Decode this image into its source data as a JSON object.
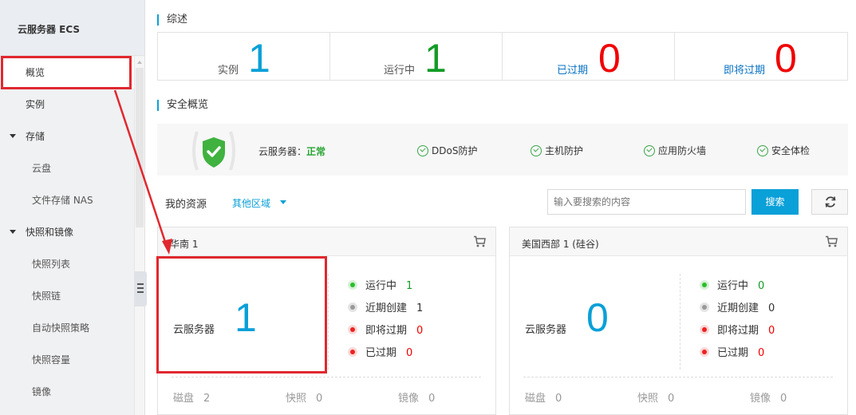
{
  "sidebar": {
    "title": "云服务器 ECS",
    "items": [
      {
        "label": "概览"
      },
      {
        "label": "实例"
      },
      {
        "label": "存储"
      },
      {
        "label": "云盘"
      },
      {
        "label": "文件存储 NAS"
      },
      {
        "label": "快照和镜像"
      },
      {
        "label": "快照列表"
      },
      {
        "label": "快照链"
      },
      {
        "label": "自动快照策略"
      },
      {
        "label": "快照容量"
      },
      {
        "label": "镜像"
      }
    ]
  },
  "overview": {
    "title": "综述",
    "stats": [
      {
        "label": "实例",
        "value": "1",
        "color": "#0aa0d8"
      },
      {
        "label": "运行中",
        "value": "1",
        "color": "#139b26"
      },
      {
        "label": "已过期",
        "value": "0",
        "color": "#f00000"
      },
      {
        "label": "即将过期",
        "value": "0",
        "color": "#f00000"
      }
    ]
  },
  "security": {
    "title": "安全概览",
    "status_label": "云服务器：",
    "status_value": "正常",
    "items": [
      "DDoS防护",
      "主机防护",
      "应用防火墙",
      "安全体检"
    ]
  },
  "resources": {
    "title": "我的资源",
    "region_filter": "其他区域",
    "search_placeholder": "输入要搜索的内容",
    "search_button": "搜索",
    "regions": [
      {
        "name": "华南 1",
        "service_label": "云服务器",
        "count": "1",
        "status": [
          {
            "label": "运行中",
            "value": "1",
            "color": "#139b26"
          },
          {
            "label": "近期创建",
            "value": "1",
            "color": "#333333"
          },
          {
            "label": "即将过期",
            "value": "0",
            "color": "#f00000"
          },
          {
            "label": "已过期",
            "value": "0",
            "color": "#f00000"
          }
        ],
        "footer": [
          {
            "label": "磁盘",
            "value": "2"
          },
          {
            "label": "快照",
            "value": "0"
          },
          {
            "label": "镜像",
            "value": "0"
          }
        ]
      },
      {
        "name": "美国西部 1 (硅谷)",
        "service_label": "云服务器",
        "count": "0",
        "status": [
          {
            "label": "运行中",
            "value": "0",
            "color": "#139b26"
          },
          {
            "label": "近期创建",
            "value": "0",
            "color": "#333333"
          },
          {
            "label": "即将过期",
            "value": "0",
            "color": "#f00000"
          },
          {
            "label": "已过期",
            "value": "0",
            "color": "#f00000"
          }
        ],
        "footer": [
          {
            "label": "磁盘",
            "value": "0"
          },
          {
            "label": "快照",
            "value": "0"
          },
          {
            "label": "镜像",
            "value": "0"
          }
        ]
      }
    ]
  },
  "colors": {
    "accent": "#0aa0d8",
    "annotation": "#e0282e"
  }
}
